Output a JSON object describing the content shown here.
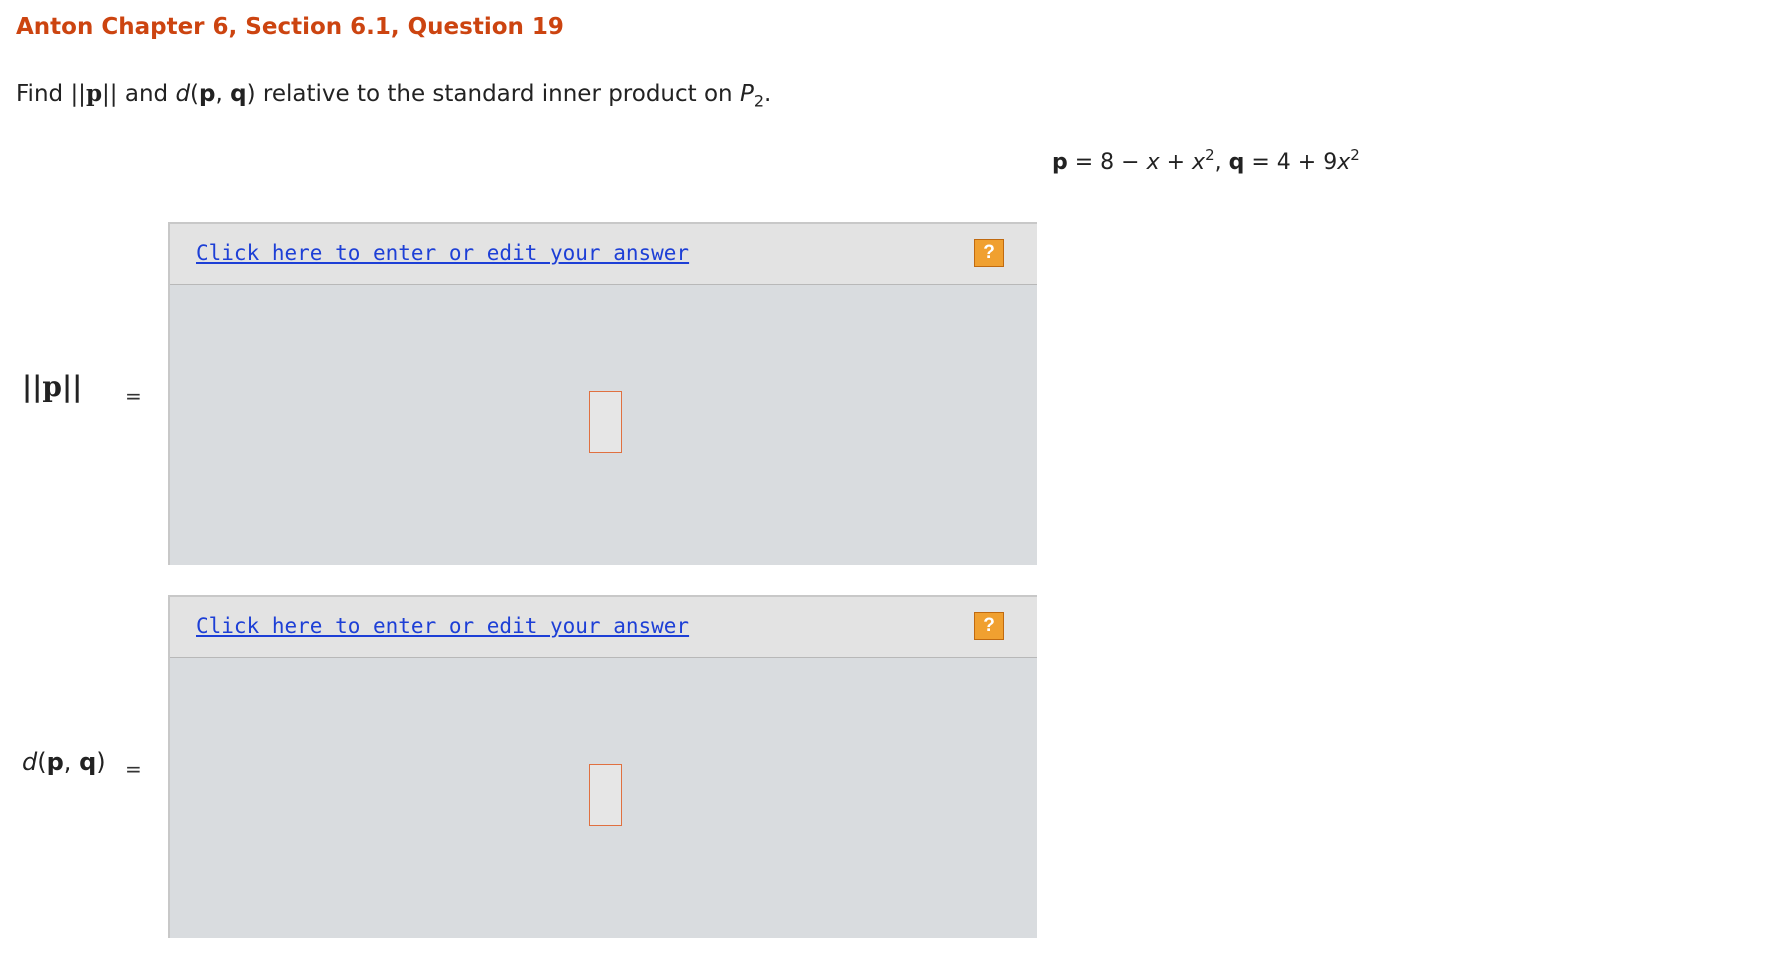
{
  "header": {
    "title": "Anton Chapter 6, Section 6.1, Question 19"
  },
  "question": {
    "find": "Find",
    "norm_bars_left": "||",
    "p_bold": "p",
    "norm_bars_right": "||",
    "and": "and",
    "d": "d",
    "open_paren": "(",
    "p": "p",
    "comma": ", ",
    "q": "q",
    "close_paren": ")",
    "rest": "relative to the standard inner product on",
    "P": "P",
    "sub": "2",
    "period": "."
  },
  "polynomials": {
    "p_label": "p",
    "p_expr_a": "= 8 − ",
    "x1": "x",
    "plus1": " + ",
    "x2": "x",
    "exp1": "2",
    "sep": ", ",
    "q_label": "q",
    "q_expr_a": " = 4 + 9",
    "x3": "x",
    "exp2": "2"
  },
  "answers": [
    {
      "label_norm": "||p||",
      "equals": "=",
      "link": "Click here to enter or edit your answer",
      "help": "?"
    },
    {
      "label_d": "d",
      "label_args_open": "(",
      "label_p": "p",
      "label_comma": ", ",
      "label_q": "q",
      "label_args_close": ")",
      "equals": "=",
      "link": "Click here to enter or edit your answer",
      "help": "?"
    }
  ],
  "colors": {
    "title": "#cc4410",
    "link": "#1d3fd6",
    "panel": "#d9dcdf",
    "help_button": "#f0a030",
    "answer_box_border": "#e07040"
  }
}
